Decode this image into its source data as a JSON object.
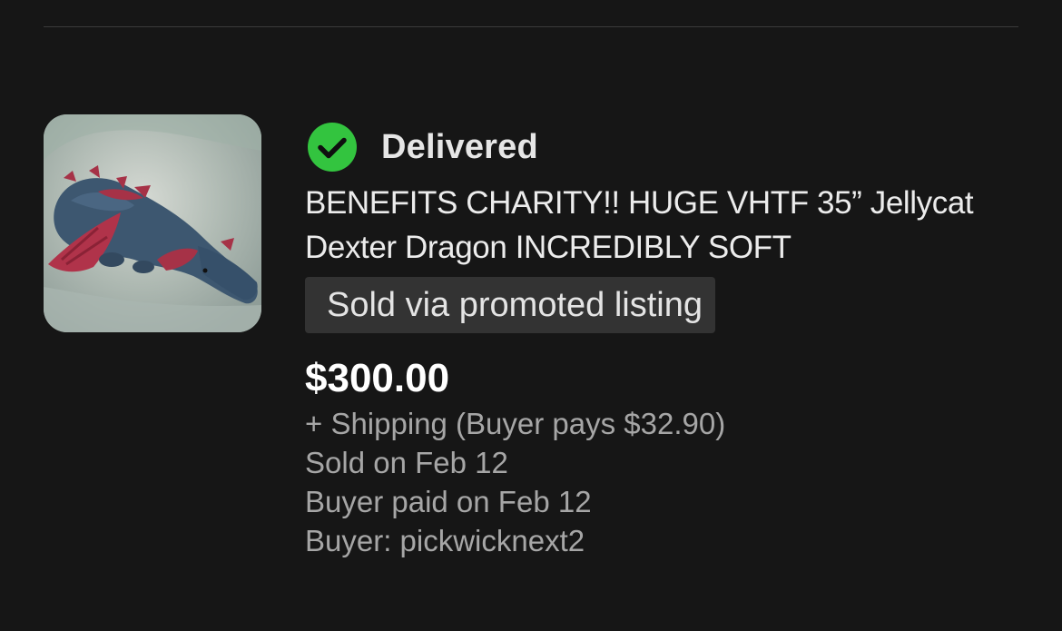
{
  "order": {
    "status": "Delivered",
    "title": "BENEFITS CHARITY!! HUGE VHTF 35” Jellycat Dexter Dragon INCREDIBLY SOFT",
    "badge": "Sold via promoted listing",
    "price": "$300.00",
    "shipping": "+ Shipping (Buyer pays $32.90)",
    "sold_on": "Sold on Feb 12",
    "paid_on": "Buyer paid on Feb 12",
    "buyer": "Buyer: pickwicknext2"
  },
  "icons": {
    "status": "check-circle-icon"
  },
  "colors": {
    "background": "#161616",
    "status_green": "#33c43f",
    "badge_bg": "#333333",
    "muted_text": "#a6a6a6"
  }
}
